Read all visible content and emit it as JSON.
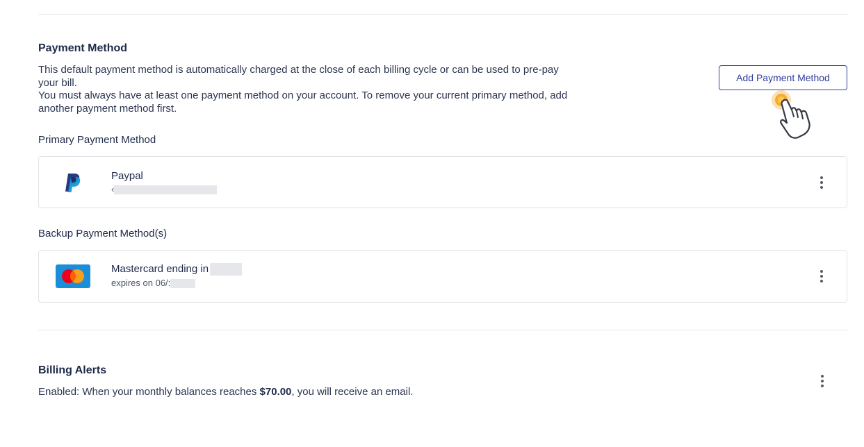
{
  "payment_method": {
    "title": "Payment Method",
    "description_line1": "This default payment method is automatically charged at the close of each billing cycle or can be used to pre-pay your bill.",
    "description_line2": "You must always have at least one payment method on your account. To remove your current primary method, add another payment method first.",
    "add_button_label": "Add Payment Method"
  },
  "primary": {
    "title": "Primary Payment Method",
    "name": "Paypal",
    "sub_prefix": "‹"
  },
  "backup": {
    "title": "Backup Payment Method(s)",
    "name": "Mastercard ending in",
    "sub_prefix": "expires on 06/:"
  },
  "billing_alerts": {
    "title": "Billing Alerts",
    "text_before": "Enabled: When your monthly balances reaches ",
    "amount": "$70.00",
    "text_after": ", you will receive an email."
  },
  "icons": [
    "paypal-logo-icon",
    "mastercard-logo-icon",
    "more-vertical-icon",
    "hand-pointer-cursor-icon"
  ],
  "colors": {
    "accent": "#2f3c9c",
    "title": "#1e2a4a",
    "border": "#dfe3e8",
    "cursor_highlight": "#f5a623"
  }
}
